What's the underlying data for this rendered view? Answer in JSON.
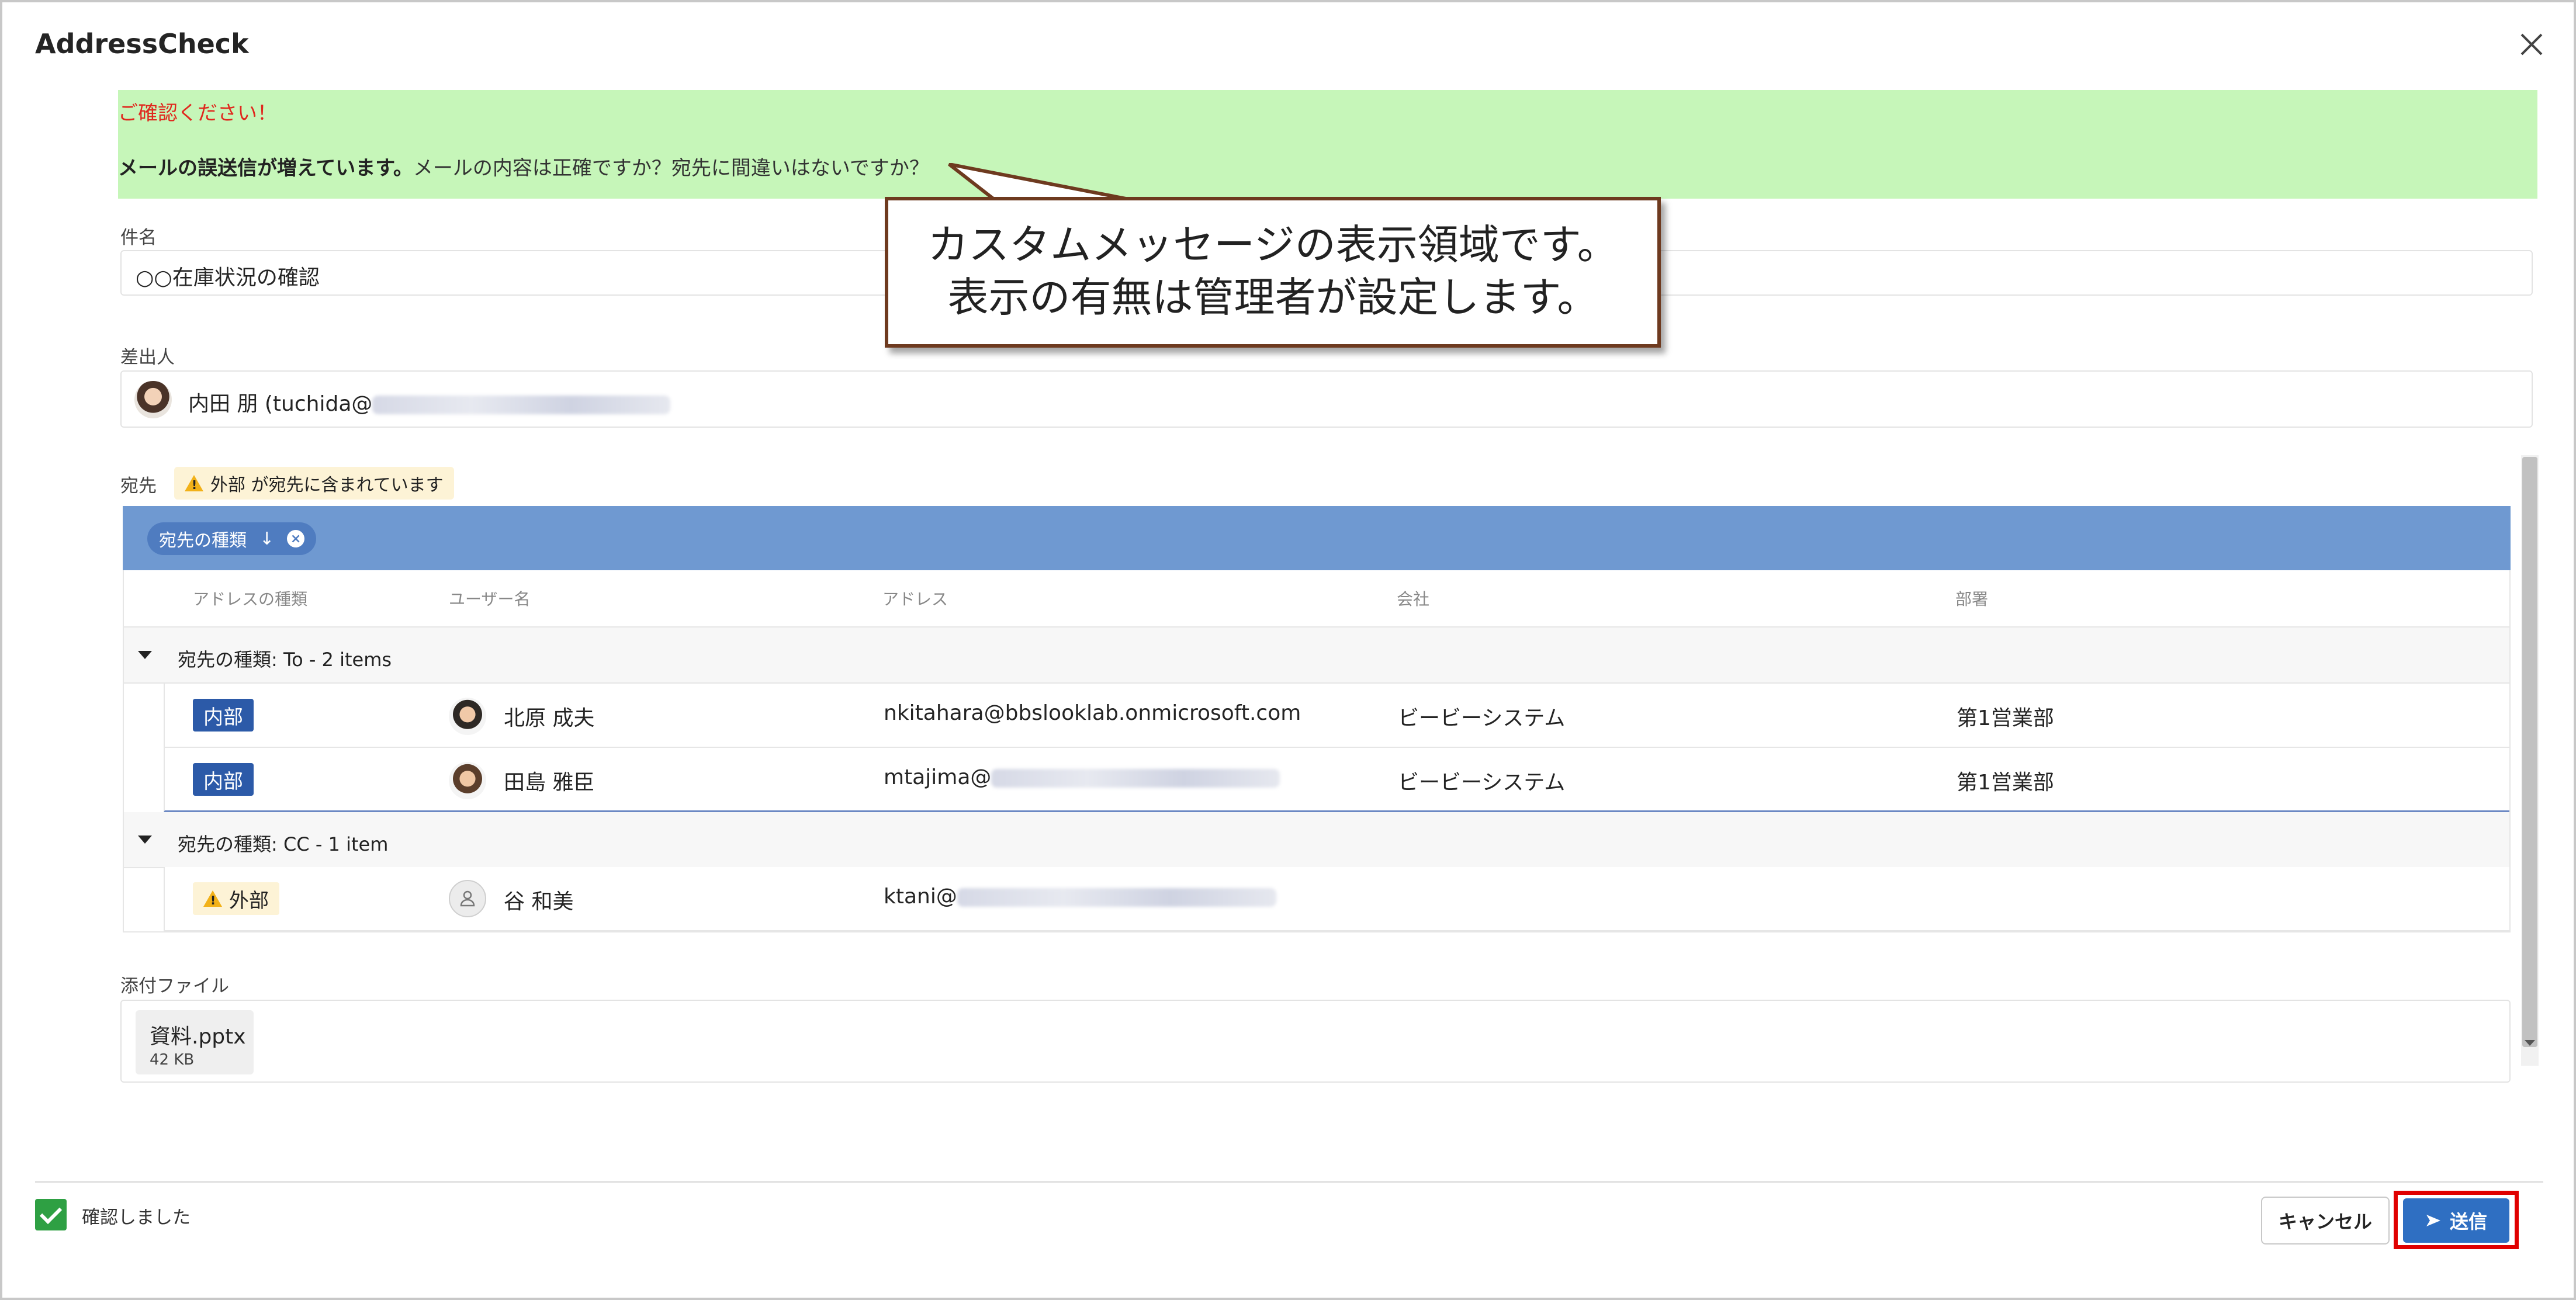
{
  "dialog": {
    "title": "AddressCheck",
    "close_icon": "close-icon"
  },
  "banner": {
    "warning": "ご確認ください！",
    "bold_text": "メールの誤送信が増えています。",
    "message": "メールの内容は正確ですか？宛先に間違いはないですか？",
    "warning_color": "#e0281e",
    "background": "#c6f6b9"
  },
  "subject": {
    "label": "件名",
    "value": "○○在庫状況の確認"
  },
  "sender": {
    "label": "差出人",
    "value": "内田 朋 (tuchida@"
  },
  "recipients": {
    "label": "宛先",
    "external_warning": "外部 が宛先に含まれています",
    "group_chip": "宛先の種類",
    "group_chip_arrow": "↓",
    "columns": [
      "アドレスの種類",
      "ユーザー名",
      "アドレス",
      "会社",
      "部署"
    ],
    "groups": [
      {
        "label": "宛先の種類: To - 2 items",
        "rows": [
          {
            "type": "内部",
            "name": "北原 成夫",
            "address": "nkitahara@bbslooklab.onmicrosoft.com",
            "company": "ビービーシステム",
            "department": "第1営業部"
          },
          {
            "type": "内部",
            "name": "田島 雅臣",
            "address": "mtajima@",
            "company": "ビービーシステム",
            "department": "第1営業部"
          }
        ]
      },
      {
        "label": "宛先の種類: CC - 1 item",
        "rows": [
          {
            "type": "外部",
            "name": "谷 和美",
            "address": "ktani@",
            "company": "",
            "department": ""
          }
        ]
      }
    ]
  },
  "attachments": {
    "label": "添付ファイル",
    "files": [
      {
        "name": "資料.pptx",
        "size": "42 KB"
      }
    ]
  },
  "footer": {
    "checkbox_label": "確認しました",
    "checked": true,
    "cancel_label": "キャンセル",
    "send_label": "送信",
    "send_color": "#2f6fc2",
    "highlight_color": "#e00000"
  },
  "callout": {
    "line1": "カスタムメッセージの表示領域です。",
    "line2": "表示の有無は管理者が設定します。"
  }
}
